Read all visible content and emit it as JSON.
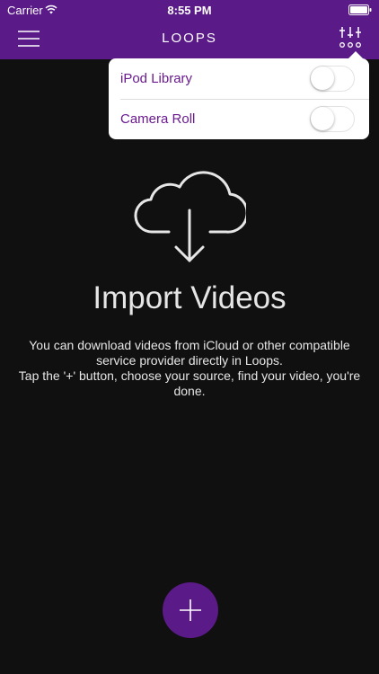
{
  "status_bar": {
    "carrier": "Carrier",
    "time": "8:55 PM"
  },
  "nav": {
    "title": "LOOPS",
    "left_icon": "hamburger-menu-icon",
    "right_icon": "sliders-icon"
  },
  "source_menu": {
    "items": [
      {
        "label": "iPod Library",
        "enabled": false
      },
      {
        "label": "Camera Roll",
        "enabled": false
      }
    ]
  },
  "empty_state": {
    "icon": "cloud-download-icon",
    "title": "Import Videos",
    "lines": [
      "You can download videos from iCloud or other compatible service provider directly in Loops.",
      "Tap the '+' button, choose your source, find your video, you're done."
    ]
  },
  "add_button": {
    "icon": "plus-icon"
  },
  "colors": {
    "brand_purple": "#5a1a87",
    "popover_text": "#6a1a8e",
    "background": "#111011"
  }
}
